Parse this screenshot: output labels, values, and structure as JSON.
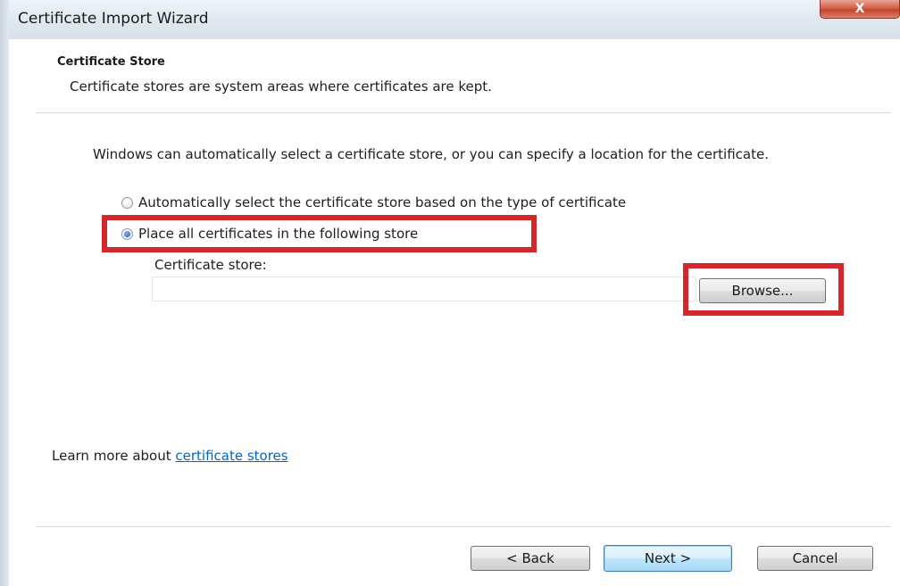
{
  "window": {
    "title": "Certificate Import Wizard",
    "close_glyph": "X"
  },
  "header": {
    "title": "Certificate Store",
    "description": "Certificate stores are system areas where certificates are kept."
  },
  "body": {
    "intro": "Windows can automatically select a certificate store, or you can specify a location for the certificate.",
    "options": [
      {
        "label": "Automatically select the certificate store based on the type of certificate",
        "selected": false
      },
      {
        "label": "Place all certificates in the following store",
        "selected": true
      }
    ],
    "store_label": "Certificate store:",
    "store_value": "",
    "browse_label": "Browse..."
  },
  "learn_more": {
    "prefix": "Learn more about ",
    "link_text": "certificate stores"
  },
  "footer": {
    "back_label": "< Back",
    "next_label": "Next >",
    "cancel_label": "Cancel"
  },
  "colors": {
    "highlight": "#d5262b",
    "link": "#0066cc",
    "close_button": "#c2442c"
  },
  "icons": [
    "close-icon",
    "radio-unchecked-icon",
    "radio-checked-icon"
  ]
}
